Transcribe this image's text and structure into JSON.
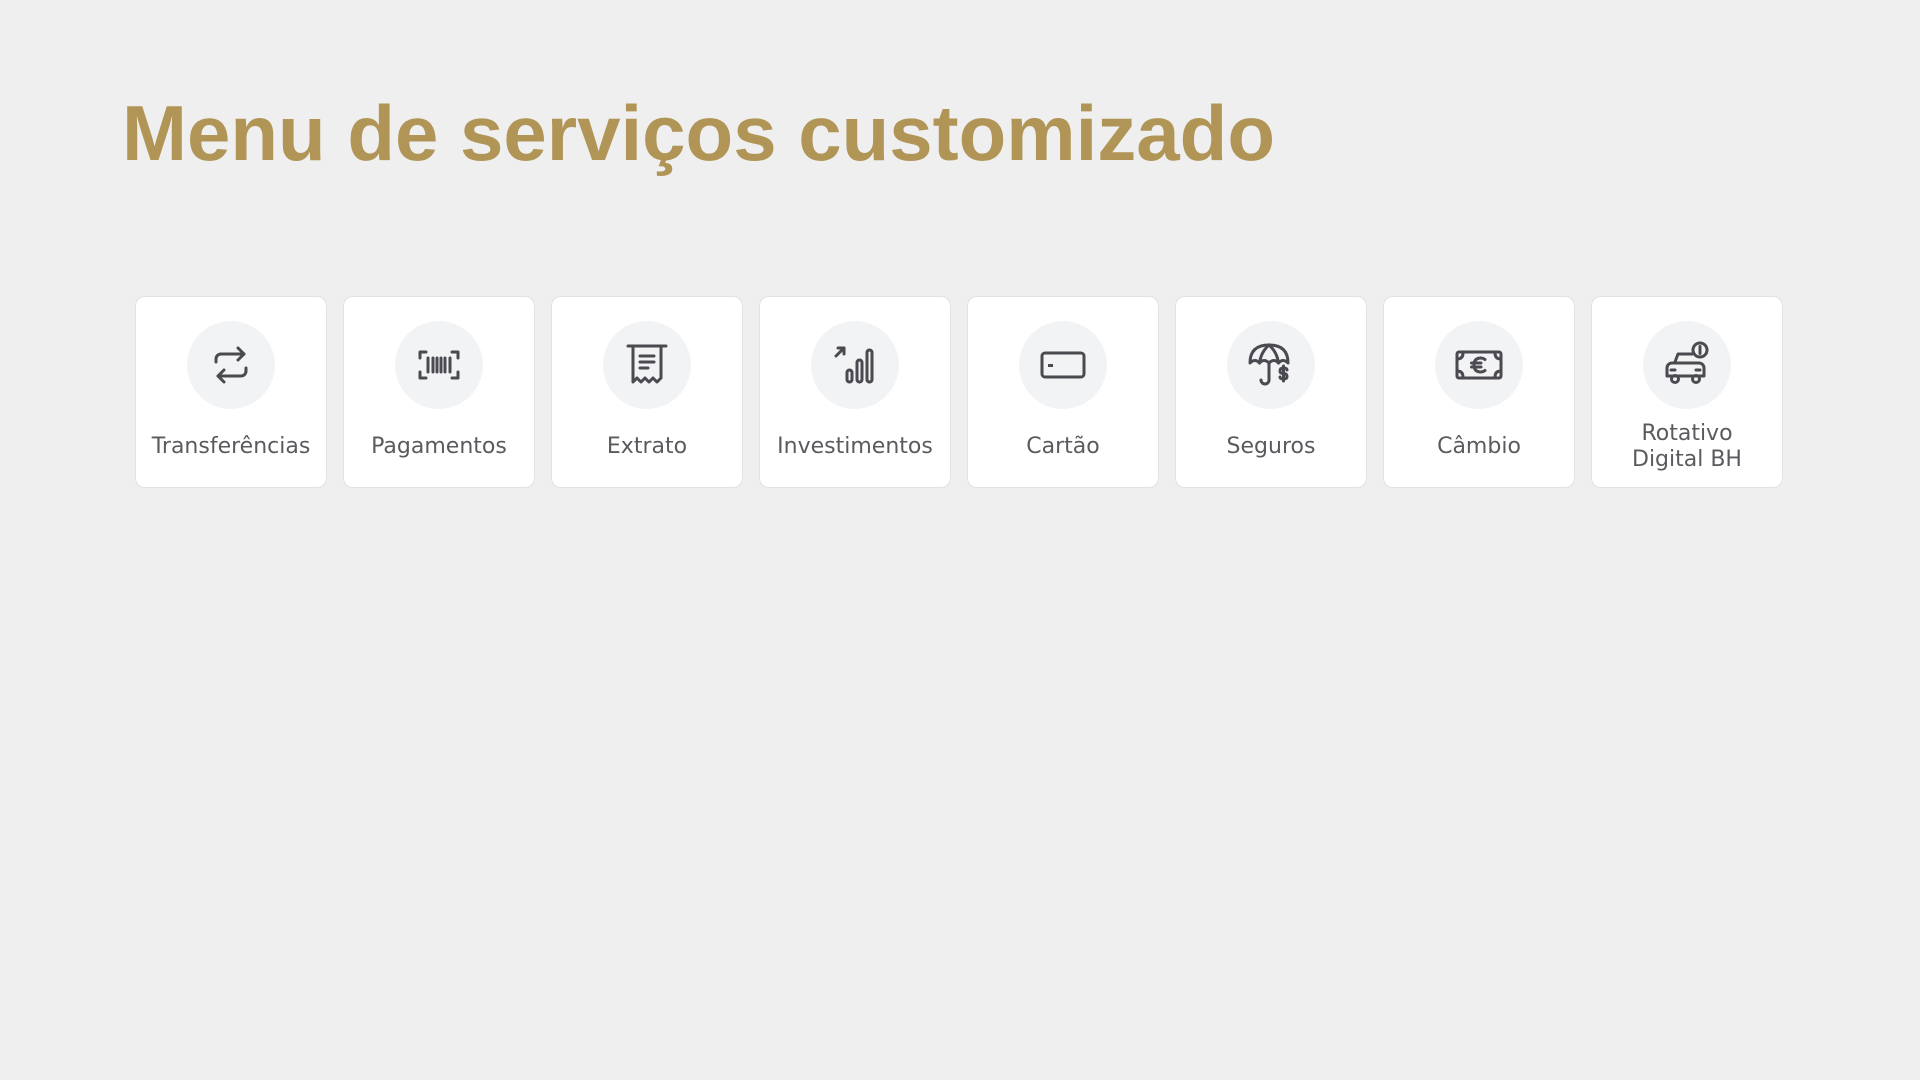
{
  "page": {
    "title": "Menu de serviços customizado"
  },
  "colors": {
    "background": "#efefef",
    "title": "#b09556",
    "card_background": "#ffffff",
    "icon_circle": "#f2f3f5",
    "icon_stroke": "#4a4a50",
    "label_text": "#5b5b5f"
  },
  "services": [
    {
      "label": "Transferências",
      "icon": "transfer-arrows-icon"
    },
    {
      "label": "Pagamentos",
      "icon": "barcode-icon"
    },
    {
      "label": "Extrato",
      "icon": "receipt-icon"
    },
    {
      "label": "Investimentos",
      "icon": "investment-chart-icon"
    },
    {
      "label": "Cartão",
      "icon": "credit-card-icon"
    },
    {
      "label": "Seguros",
      "icon": "umbrella-dollar-icon"
    },
    {
      "label": "Câmbio",
      "icon": "euro-banknote-icon"
    },
    {
      "label_line1": "Rotativo",
      "label_line2": "Digital BH",
      "icon": "car-coin-icon"
    }
  ]
}
